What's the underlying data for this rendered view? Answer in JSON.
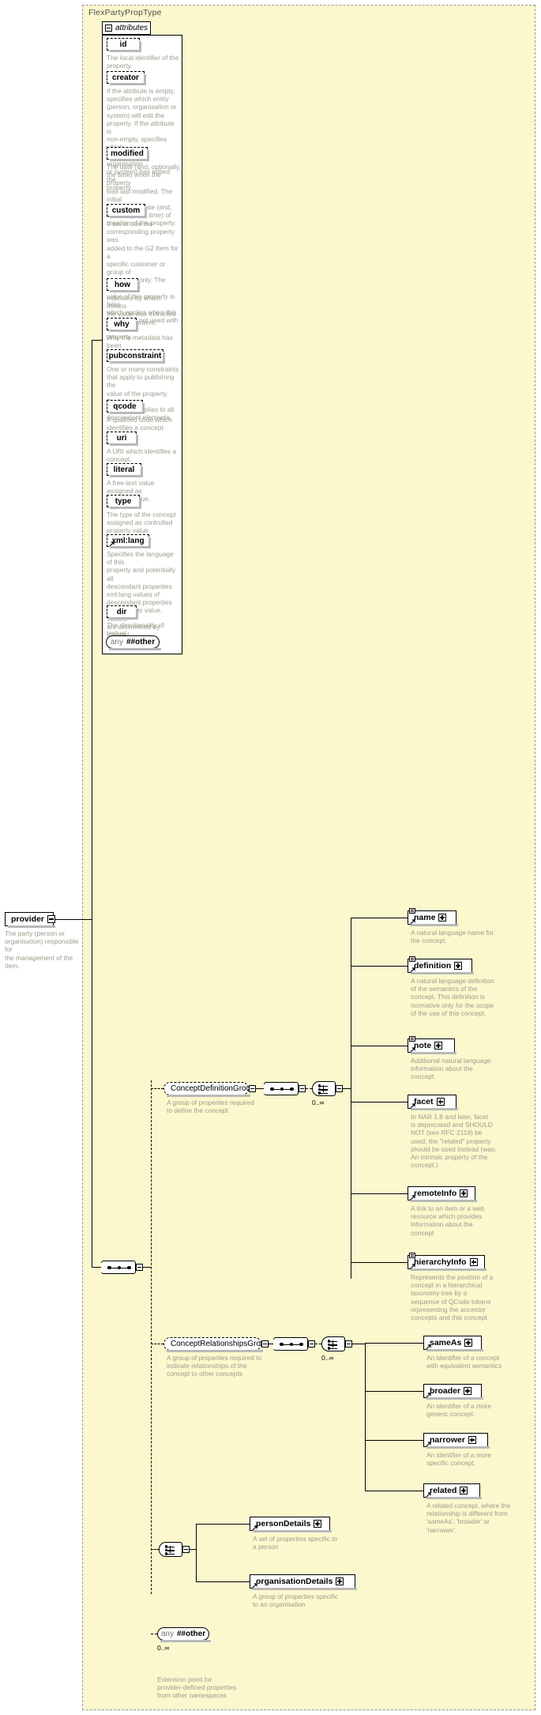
{
  "type": {
    "name": "FlexPartyPropType"
  },
  "attributes_section": {
    "label": "attributes",
    "items": [
      {
        "name": "id",
        "doc": "The local identifier of the\nproperty."
      },
      {
        "name": "creator",
        "doc": "If the attribute is empty,\nspecifies which entity\n(person, organisation or\nsystem) will edit the\nproperty. If the attribute is\nnon-empty, specifies which\nentity (person, organisation\nor system) has edited the\nproperty."
      },
      {
        "name": "modified",
        "doc": "The date (and, optionally,\nthe time) when the property\nwas last modified. The initial\nvalue is the date (and,\noptionally, the time) of\ncreation of the property."
      },
      {
        "name": "custom",
        "doc": "If set to true the\ncorresponding property was\nadded to the G2 Item for a\nspecific customer or group of\ncustomers only. The default\nvalue of this property is false\nwhich applies when this\nattribute is not used with the\nproperty."
      },
      {
        "name": "how",
        "doc": "Indicates by which means\nthe value was extracted\nfrom the content."
      },
      {
        "name": "why",
        "doc": "Why the metadata has been\nincluded."
      },
      {
        "name": "pubconstraint",
        "doc": "One or many constraints\nthat apply to publishing the\nvalue of the property. Each\nconstraint applies to all\ndescendant elements."
      },
      {
        "name": "qcode",
        "doc": "A qualified code which\nidentifies a concept."
      },
      {
        "name": "uri",
        "doc": "A URI which identifies a\nconcept."
      },
      {
        "name": "literal",
        "doc": "A free-text value assigned as\nproperty value."
      },
      {
        "name": "type",
        "doc": "The type of the concept\nassigned as controlled\nproperty value."
      },
      {
        "name": "xml:lang",
        "doc": "Specifies the language of this\nproperty and potentially all\ndescendant properties.\nxml:lang values of\ndescendant properties\noverride this value. Values\nare determined by Internet\nBCP 47."
      },
      {
        "name": "dir",
        "doc": "The directionality of textual\ncontent."
      }
    ],
    "any": {
      "word": "any",
      "ns": "##other"
    }
  },
  "root_element": {
    "name": "provider",
    "doc": "The party (person or\norganisation) responsible for\nthe management of the\nItem."
  },
  "groups": [
    {
      "name": "ConceptDefinitionGroup",
      "doc": "A group of properites required\nto define the concept",
      "occurrence": "0..∞"
    },
    {
      "name": "ConceptRelationshipsGroup",
      "doc": "A group of properties required to\nindicate relationships of the\nconcept to other concepts",
      "occurrence": "0..∞"
    }
  ],
  "definition_elements": [
    {
      "name": "name",
      "doc": "A natural language name for\nthe concept."
    },
    {
      "name": "definition",
      "doc": "A natural language definition\nof the semantics of the\nconcept. This definition is\nnormative only for the scope\nof the use of this concept."
    },
    {
      "name": "note",
      "doc": "Additional natural language\ninformation about the\nconcept."
    },
    {
      "name": "facet",
      "doc": "In NAR 1.8 and later, facet\nis deprecated and SHOULD\nNOT (see RFC 2119) be\nused, the \"related\" property\nshould be used instead (was:\nAn intrinsic property of the\nconcept.)"
    },
    {
      "name": "remoteInfo",
      "doc": "A link to an item or a web\nresource which provides\ninformation about the\nconcept"
    },
    {
      "name": "hierarchyInfo",
      "doc": "Represents the position of a\nconcept in a hierarchical\ntaxonomy tree by a\nsequence of QCode tokens\nrepresenting the ancestor\nconcepts and this concept"
    }
  ],
  "relationship_elements": [
    {
      "name": "sameAs",
      "doc": "An identifier of a concept\nwith equivalent semantics"
    },
    {
      "name": "broader",
      "doc": "An identifier of a more\ngeneric concept."
    },
    {
      "name": "narrower",
      "doc": "An identifier of a more\nspecific concept."
    },
    {
      "name": "related",
      "doc": "A related concept, where the\nrelationship is different from\n'sameAs', 'broader' or\n'narrower'."
    }
  ],
  "detail_elements": [
    {
      "name": "personDetails",
      "doc": "A set of properties specific to\na person"
    },
    {
      "name": "organisationDetails",
      "doc": "A group of properties specific\nto an organisation"
    }
  ],
  "trailing_any": {
    "word": "any",
    "ns": "##other",
    "occurrence": "0..∞",
    "doc": "Extension point for\nprovider-defined properties\nfrom other namespaces"
  }
}
